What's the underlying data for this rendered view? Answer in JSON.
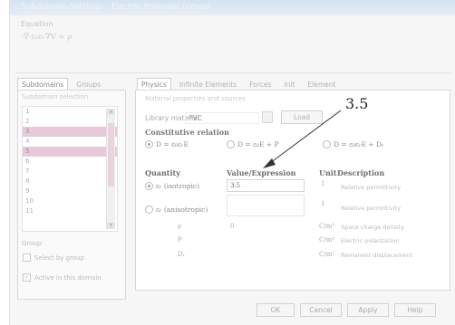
{
  "window": {
    "title": "Subdomain Settings - Electric Potential (emes)"
  },
  "equation": {
    "label": "Equation",
    "text": "-∇·ε₀εᵣ∇V = ρ"
  },
  "left_tabs": [
    {
      "label": "Subdomains"
    },
    {
      "label": "Groups"
    }
  ],
  "right_tabs": [
    {
      "label": "Physics"
    },
    {
      "label": "Infinite Elements"
    },
    {
      "label": "Forces"
    },
    {
      "label": "Init"
    },
    {
      "label": "Element"
    }
  ],
  "subdomain_selection": {
    "label": "Subdomain selection",
    "items": [
      "1",
      "2",
      "3",
      "4",
      "5",
      "6",
      "7",
      "8",
      "9",
      "10",
      "11"
    ],
    "selected": [
      "3",
      "5"
    ]
  },
  "group_label": "Group:",
  "select_by_group": "Select by group",
  "active_in_domain": "Active in this domain",
  "material": {
    "section_label": "Material properties and sources",
    "library_label": "Library material:",
    "library_value": "PVC",
    "load_button": "Load"
  },
  "constitutive": {
    "label": "Constitutive relation",
    "options": [
      {
        "label": "D = ε₀εᵣE",
        "selected": true
      },
      {
        "label": "D = ε₀E + P",
        "selected": false
      },
      {
        "label": "D = ε₀εᵣE + Dᵣ",
        "selected": false
      }
    ]
  },
  "table": {
    "headers": {
      "quantity": "Quantity",
      "value": "Value/Expression",
      "unit": "Unit",
      "description": "Description"
    },
    "rows": [
      {
        "quantity": "εᵣ (isotropic)",
        "value": "3.5",
        "unit": "1",
        "description": "Relative permittivity",
        "radio": true,
        "selected": true
      },
      {
        "quantity": "εᵣ (anisotropic)",
        "value": "",
        "unit": "1",
        "description": "Relative permittivity",
        "radio": true,
        "selected": false
      },
      {
        "quantity": "ρ",
        "value": "0",
        "unit": "C/m³",
        "description": "Space charge density",
        "radio": false
      },
      {
        "quantity": "P",
        "value": "",
        "unit": "C/m²",
        "description": "Electric polarization",
        "radio": false
      },
      {
        "quantity": "Dᵣ",
        "value": "",
        "unit": "C/m²",
        "description": "Remanent displacement",
        "radio": false
      }
    ]
  },
  "buttons": {
    "ok": "OK",
    "cancel": "Cancel",
    "apply": "Apply",
    "help": "Help"
  },
  "annotation": {
    "text": "3.5"
  }
}
